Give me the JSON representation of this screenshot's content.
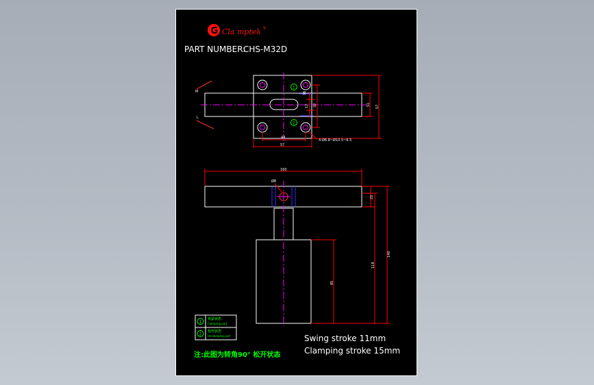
{
  "logo": {
    "mark": "G",
    "text": "Cla mptek",
    "reg": "®"
  },
  "part": {
    "label": "PART NUMBER:",
    "value": "CHS-M32D"
  },
  "top_view": {
    "dims": {
      "d44": "44",
      "d57": "57",
      "d16": "16",
      "d32": "32",
      "d51": "51",
      "d57b": "57",
      "dia12": "12"
    },
    "hole_note": "4-Ø6.8~Ø10.5~6.5",
    "markers": {
      "m1": "1",
      "m2": "2"
    }
  },
  "front_view": {
    "dims": {
      "d160": "160",
      "d22": "22",
      "d140": "140",
      "d118": "118",
      "d85": "85",
      "ds8": "Ø8"
    }
  },
  "legend": [
    {
      "num": "1",
      "cn": "夹紧状态",
      "en": "Clamping part"
    },
    {
      "num": "2",
      "cn": "松开状态",
      "en": "Unclamping part"
    }
  ],
  "stroke": {
    "swing": "Swing stroke 11mm",
    "clamping": "Clamping stroke 15mm"
  },
  "note": "注:此图为转角90° 松开状态",
  "colors": {
    "background": "#000000",
    "outline": "#ffffff",
    "dimension": "#ff0000",
    "centerline": "#ff00ff",
    "note": "#00ff00",
    "hidden": "#0000ff",
    "logo": "#ff1010"
  }
}
